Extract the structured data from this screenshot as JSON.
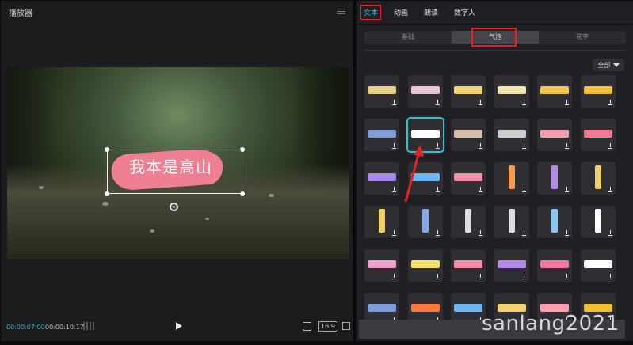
{
  "player": {
    "title": "播放器",
    "subtitle_text": "我本是高山",
    "time_current": "00:00:07:00",
    "time_total": "00:00:10:17",
    "ratio": "16:9"
  },
  "panel": {
    "nav": [
      {
        "label": "文本",
        "active": true
      },
      {
        "label": "动画",
        "active": false
      },
      {
        "label": "朗读",
        "active": false
      },
      {
        "label": "数字人",
        "active": false
      }
    ],
    "subtabs": [
      {
        "label": "基础",
        "active": false
      },
      {
        "label": "气泡",
        "active": true
      },
      {
        "label": "花字",
        "active": false
      }
    ],
    "filter_label": "全部"
  },
  "watermark": "sanlang2021",
  "colors": {
    "accent": "#2fc2d4",
    "highlight_red": "#e32323",
    "bubble_pink": "#ef7f92"
  },
  "tile_colors": [
    [
      "#e8d08a",
      "#e9c6d4",
      "#f0d36a",
      "#f3e7b0",
      "#f2c84a",
      "#f0c33a"
    ],
    [
      "#7f9bd8",
      "#ffffff",
      "#d8c0a8",
      "#cfcfcf",
      "#f0a0b0",
      "#f27a93"
    ],
    [
      "#a78be6",
      "#6fb6f0",
      "#f08fa7",
      "#ff9a4a",
      "#b48be8",
      "#f0d060"
    ],
    [
      "#f0d060",
      "#88a8e8",
      "#dddddd",
      "#dddddd",
      "#88c8f0",
      "#ffffff"
    ],
    [
      "#f2a0d0",
      "#f2e070",
      "#f08fa7",
      "#b48be8",
      "#f27aa0",
      "#ffffff"
    ],
    [
      "#7f9bd8",
      "#ff7a3a",
      "#6fb6f0",
      "#f0d36a",
      "#ff9fb0",
      "#f0c030"
    ]
  ]
}
